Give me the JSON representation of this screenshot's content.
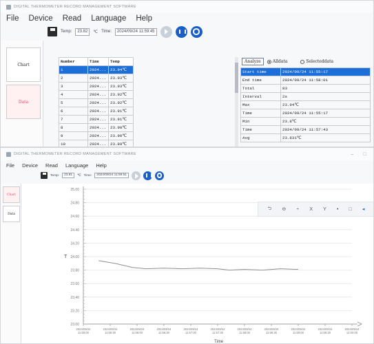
{
  "app": {
    "title": "DIGITAL THERMOMETER RECORD MANAGEMENT SOFTWARE",
    "menu": [
      "File",
      "Device",
      "Read",
      "Language",
      "Help"
    ]
  },
  "window1": {
    "toolbar": {
      "temp_label": "Temp:",
      "temp_value": "23.82",
      "unit": "℃",
      "time_label": "Time:",
      "time_value": "2024/09/24 11:59:45"
    },
    "side_tabs": [
      "Chart",
      "Data"
    ],
    "selected_tab": "Data",
    "data_table": {
      "columns": [
        "Number",
        "Time",
        "Temp"
      ],
      "rows": [
        [
          "1",
          "2024...",
          "23.94℃"
        ],
        [
          "2",
          "2024...",
          "23.93℃"
        ],
        [
          "3",
          "2024...",
          "23.93℃"
        ],
        [
          "4",
          "2024...",
          "23.92℃"
        ],
        [
          "5",
          "2024...",
          "23.92℃"
        ],
        [
          "6",
          "2024...",
          "23.91℃"
        ],
        [
          "7",
          "2024...",
          "23.91℃"
        ],
        [
          "8",
          "2024...",
          "23.90℃"
        ],
        [
          "9",
          "2024...",
          "23.90℃"
        ],
        [
          "10",
          "2024...",
          "23.89℃"
        ]
      ],
      "selected_row": 0
    },
    "analyze": {
      "button": "Analyze",
      "radio_all": "Alldata",
      "radio_selected": "Selecteddata",
      "selected_radio": "Alldata",
      "rows": [
        [
          "Start time",
          "2024/09/24 11:55:17"
        ],
        [
          "End time",
          "2024/09/24 11:58:01"
        ],
        [
          "Total",
          "83"
        ],
        [
          "Interval",
          "2s"
        ],
        [
          "Max",
          "23.94℃"
        ],
        [
          "Time",
          "2024/09/24 11:55:17"
        ],
        [
          "Min",
          "23.8℃"
        ],
        [
          "Time",
          "2024/09/24 11:57:43"
        ],
        [
          "Avg",
          "23.831℃"
        ]
      ],
      "selected_row": 0
    }
  },
  "window2": {
    "toolbar": {
      "temp_label": "Temp:",
      "temp_value": "23.81",
      "unit": "℃",
      "time_label": "Time:",
      "time_value": "2024/09/24 11:59:51"
    },
    "side_tabs": [
      "Chart",
      "Data"
    ],
    "selected_tab": "Chart",
    "chart_toolbar": [
      "⮌",
      "⊖",
      "÷",
      "X",
      "Y",
      "•",
      "□",
      "◂"
    ]
  },
  "chart_data": {
    "type": "line",
    "ylabel": "T",
    "xlabel": "Time",
    "ylim": [
      23.0,
      25.0
    ],
    "yticks": [
      "25.00",
      "24.80",
      "24.60",
      "24.40",
      "24.20",
      "24.00",
      "23.80",
      "23.60",
      "23.40",
      "23.20",
      "23.00"
    ],
    "xticks": [
      "2024/09/24 11:55:00",
      "2024/09/24 11:55:30",
      "2024/09/24 11:56:00",
      "2024/09/24 11:56:30",
      "2024/09/24 11:57:00",
      "2024/09/24 11:57:30",
      "2024/09/24 11:58:00",
      "2024/09/24 11:58:30",
      "2024/09/24 11:59:00",
      "2024/09/24 11:59:30",
      "2024/09/24 12:00:00"
    ],
    "grid": true,
    "series": [
      {
        "color": "#8a8d93",
        "x": [
          "11:55:17",
          "11:55:35",
          "11:55:55",
          "11:56:10",
          "11:56:30",
          "11:56:50",
          "11:57:10",
          "11:57:30",
          "11:57:43",
          "11:58:00",
          "11:58:20",
          "11:58:40",
          "11:59:00"
        ],
        "x_index": [
          0.57,
          1.17,
          1.83,
          2.33,
          3.0,
          3.67,
          4.33,
          5.0,
          5.43,
          6.0,
          6.67,
          7.33,
          8.0
        ],
        "values": [
          23.94,
          23.9,
          23.84,
          23.82,
          23.83,
          23.82,
          23.83,
          23.82,
          23.8,
          23.81,
          23.8,
          23.82,
          23.81
        ]
      }
    ]
  }
}
